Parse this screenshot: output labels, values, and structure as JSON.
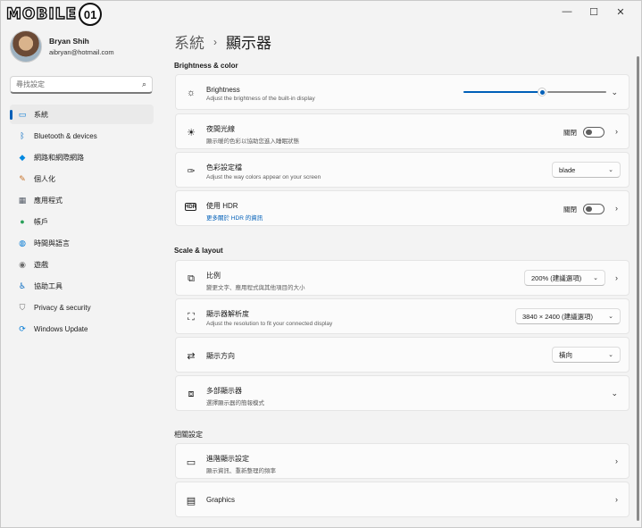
{
  "window": {
    "logo_text": "MOBILE",
    "logo_badge": "01",
    "minimize": "—",
    "maximize": "☐",
    "close": "✕"
  },
  "profile": {
    "name": "Bryan Shih",
    "email": "aibryan@hotmail.com"
  },
  "search": {
    "placeholder": "尋找設定"
  },
  "sidebar": {
    "items": [
      {
        "label": "系統",
        "icon": "system-icon",
        "glyph": "▭",
        "color": "#0078d4"
      },
      {
        "label": "Bluetooth & devices",
        "icon": "bluetooth-icon",
        "glyph": "ᛒ",
        "color": "#0067c0"
      },
      {
        "label": "網路和網際網路",
        "icon": "wifi-icon",
        "glyph": "◆",
        "color": "#0088e0"
      },
      {
        "label": "個人化",
        "icon": "brush-icon",
        "glyph": "✎",
        "color": "#c7732a"
      },
      {
        "label": "應用程式",
        "icon": "apps-icon",
        "glyph": "▦",
        "color": "#555d69"
      },
      {
        "label": "帳戶",
        "icon": "account-icon",
        "glyph": "●",
        "color": "#2aa05a"
      },
      {
        "label": "時間與語言",
        "icon": "globe-icon",
        "glyph": "◍",
        "color": "#0078d4"
      },
      {
        "label": "遊戲",
        "icon": "gamepad-icon",
        "glyph": "◉",
        "color": "#6b6b6b"
      },
      {
        "label": "協助工具",
        "icon": "accessibility-icon",
        "glyph": "♿",
        "color": "#0067c0"
      },
      {
        "label": "Privacy & security",
        "icon": "shield-icon",
        "glyph": "⛉",
        "color": "#6b6b6b"
      },
      {
        "label": "Windows Update",
        "icon": "update-icon",
        "glyph": "⟳",
        "color": "#0078d4"
      }
    ]
  },
  "breadcrumb": {
    "parent": "系統",
    "separator": "›",
    "current": "顯示器"
  },
  "sections": {
    "brightness_color": "Brightness & color",
    "scale_layout": "Scale & layout",
    "related": "相關設定"
  },
  "cards": {
    "brightness": {
      "title": "Brightness",
      "sub": "Adjust the brightness of the built-in display",
      "value": 0.55
    },
    "night_light": {
      "title": "夜間光線",
      "sub": "顯示暖的色彩以協助您進入睡眠狀態",
      "toggle_label": "關閉"
    },
    "color_profile": {
      "title": "色彩設定檔",
      "sub": "Adjust the way colors appear on your screen",
      "selected": "blade"
    },
    "hdr": {
      "title": "使用 HDR",
      "link": "更多關於 HDR 的資訊",
      "toggle_label": "關閉"
    },
    "scale": {
      "title": "比例",
      "sub": "變更文字、應用程式與其他項目的大小",
      "selected": "200% (建議選項)"
    },
    "resolution": {
      "title": "顯示器解析度",
      "sub": "Adjust the resolution to fit your connected display",
      "selected": "3840 × 2400 (建議選項)"
    },
    "orientation": {
      "title": "顯示方向",
      "selected": "橫向"
    },
    "multi": {
      "title": "多部顯示器",
      "sub": "選擇顯示器的簡報模式"
    },
    "advanced": {
      "title": "進階顯示設定",
      "sub": "顯示資訊、重新整理的頻率"
    },
    "graphics": {
      "title": "Graphics"
    }
  },
  "colors": {
    "accent": "#005fb8"
  }
}
